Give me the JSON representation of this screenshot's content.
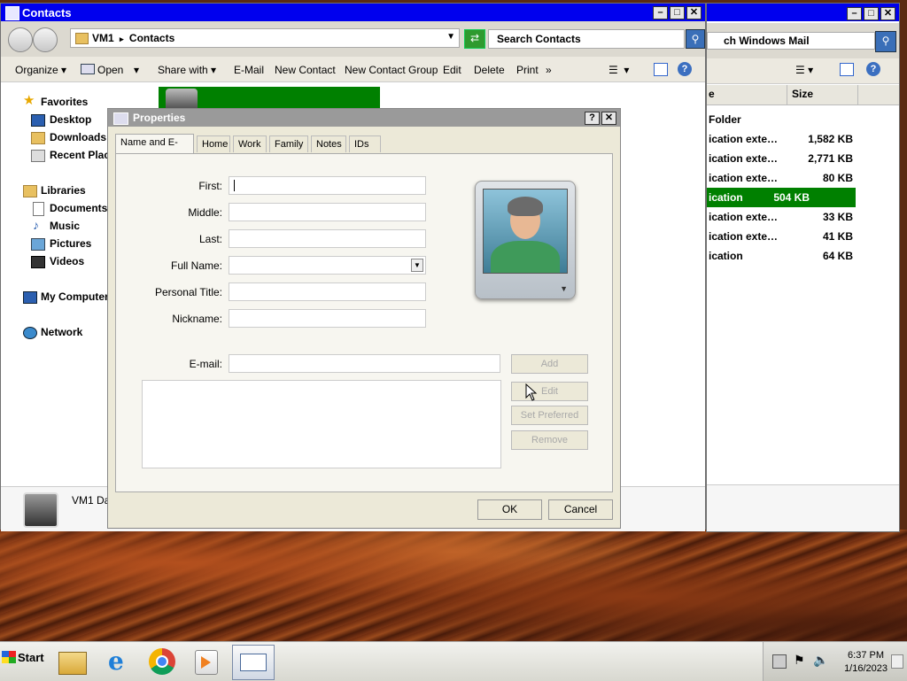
{
  "main_window": {
    "title": "Contacts",
    "address_root": "VM1",
    "address_sep": "▸",
    "address_folder": "Contacts",
    "search_placeholder": "Search Contacts",
    "toolbar": {
      "organize": "Organize",
      "open": "Open",
      "share_with": "Share with",
      "email": "E-Mail",
      "new_contact": "New Contact",
      "new_contact_group": "New Contact Group",
      "edit": "Edit",
      "delete": "Delete",
      "print": "Print",
      "more": "»"
    },
    "nav": {
      "favorites": "Favorites",
      "desktop": "Desktop",
      "downloads": "Downloads",
      "recent_places": "Recent Places",
      "libraries": "Libraries",
      "documents": "Documents",
      "music": "Music",
      "pictures": "Pictures",
      "videos": "Videos",
      "my_computer": "My Computer",
      "network": "Network"
    },
    "details_name": "VM1 Da"
  },
  "back_window": {
    "search_placeholder": "ch Windows Mail",
    "col_name_partial": "e",
    "col_size": "Size",
    "rows": [
      {
        "name": "Folder",
        "size": ""
      },
      {
        "name": "ication exte…",
        "size": "1,582 KB"
      },
      {
        "name": "ication exte…",
        "size": "2,771 KB"
      },
      {
        "name": "ication exte…",
        "size": "80 KB"
      },
      {
        "name": "ication",
        "size": "504 KB",
        "selected": true
      },
      {
        "name": "ication exte…",
        "size": "33 KB"
      },
      {
        "name": "ication exte…",
        "size": "41 KB"
      },
      {
        "name": "ication",
        "size": "64 KB"
      }
    ]
  },
  "dialog": {
    "title": "Properties",
    "help": "?",
    "close": "✕",
    "tabs": [
      "Name and E-mail",
      "Home",
      "Work",
      "Family",
      "Notes",
      "IDs"
    ],
    "labels": {
      "first": "First:",
      "middle": "Middle:",
      "last": "Last:",
      "full_name": "Full Name:",
      "personal_title": "Personal Title:",
      "nickname": "Nickname:",
      "email": "E-mail:"
    },
    "buttons": {
      "add": "Add",
      "edit": "Edit",
      "set_preferred": "Set Preferred",
      "remove": "Remove",
      "ok": "OK",
      "cancel": "Cancel"
    }
  },
  "taskbar": {
    "start": "Start",
    "time": "6:37 PM",
    "date": "1/16/2023"
  },
  "colors": {
    "titlebar": "#0000ee",
    "selection": "#008000"
  }
}
